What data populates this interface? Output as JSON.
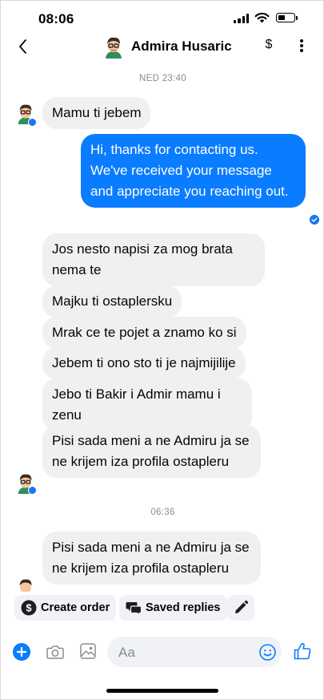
{
  "status_bar": {
    "time": "08:06",
    "icons": [
      "cellular-signal-icon",
      "wifi-icon",
      "battery-icon"
    ]
  },
  "header": {
    "contact_name": "Admira Husaric",
    "currency_icon_label": "$",
    "icons": [
      "chevron-left-icon",
      "avatar",
      "dollar-icon",
      "more-vertical-icon"
    ]
  },
  "conversation": {
    "timestamp_1": "NED 23:40",
    "timestamp_2": "06:36",
    "messages": [
      {
        "direction": "incoming",
        "text": "Mamu ti jebem"
      },
      {
        "direction": "outgoing",
        "text": "Hi, thanks for contacting us. We've received your message and appreciate you reaching out."
      },
      {
        "direction": "incoming",
        "text": "Jos nesto napisi za mog brata nema te"
      },
      {
        "direction": "incoming",
        "text": "Majku ti ostaplersku"
      },
      {
        "direction": "incoming",
        "text": "Mrak ce te pojet a znamo ko si"
      },
      {
        "direction": "incoming",
        "text": "Jebem ti ono sto ti je najmijilije"
      },
      {
        "direction": "incoming",
        "text": "Jebo ti Bakir i Admir mamu i zenu"
      },
      {
        "direction": "incoming",
        "text": "Pisi sada meni a ne Admiru ja se ne krijem iza profila ostapleru"
      },
      {
        "direction": "incoming",
        "text": "Pisi sada meni a ne Admiru ja se ne krijem iza profila ostapleru"
      }
    ]
  },
  "quick_actions": {
    "create_order": "Create order",
    "saved_replies": "Saved replies",
    "icons": [
      "dollar-circle-icon",
      "saved-replies-icon",
      "pencil-icon"
    ]
  },
  "composer": {
    "placeholder": "Aa",
    "icons": [
      "plus-icon",
      "camera-icon",
      "image-icon",
      "emoji-icon",
      "thumbs-up-icon"
    ]
  },
  "colors": {
    "accent": "#0a7cff",
    "incoming_bubble": "#f0f0f0",
    "outgoing_bubble": "#0a7cff",
    "timestamp": "#8a8d91"
  }
}
